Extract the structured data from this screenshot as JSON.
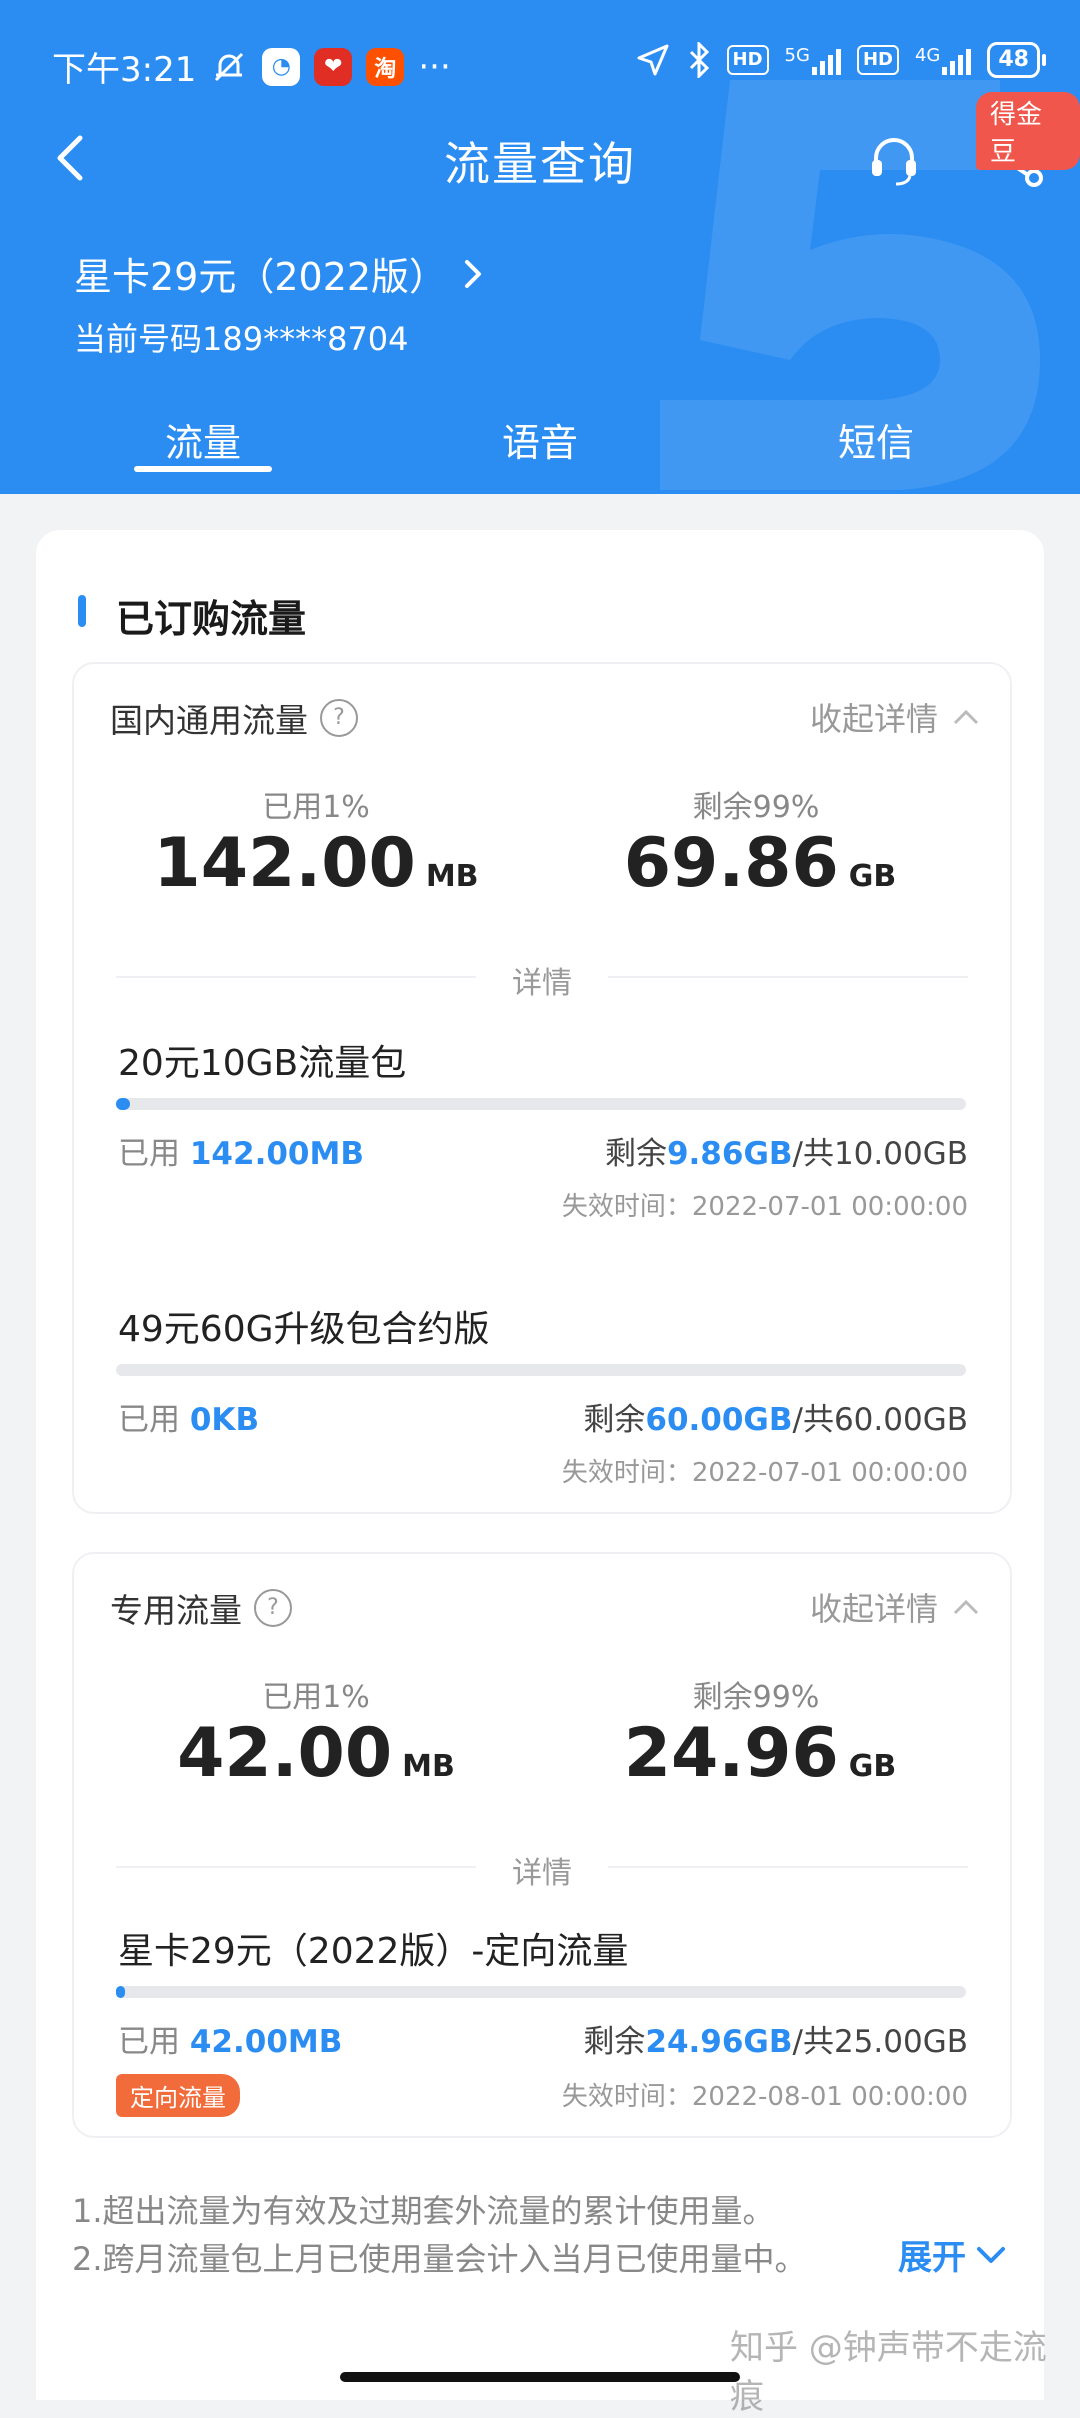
{
  "status_bar": {
    "time": "下午3:21",
    "app3": "淘",
    "more": "···",
    "sig1": "5G",
    "sig2": "4G",
    "hd": "HD",
    "battery": "48"
  },
  "header": {
    "title": "流量查询",
    "badge": "得金豆",
    "plan_name": "星卡29元（2022版）",
    "phone": "当前号码189****8704"
  },
  "tabs": [
    "流量",
    "语音",
    "短信"
  ],
  "section_title": "已订购流量",
  "domestic": {
    "title": "国内通用流量",
    "collapse_label": "收起详情",
    "used_label": "已用1%",
    "used_value": "142.00",
    "used_unit": "MB",
    "remain_label": "剩余99%",
    "remain_value": "69.86",
    "remain_unit": "GB",
    "detail_label": "详情",
    "packages": [
      {
        "name": "20元10GB流量包",
        "used_prefix": "已用",
        "used": "142.00MB",
        "remain_prefix": "剩余",
        "remain": "9.86GB",
        "total": "/共10.00GB",
        "expire": "失效时间：2022-07-01 00:00:00",
        "progress": 0.014
      },
      {
        "name": "49元60G升级包合约版",
        "used_prefix": "已用",
        "used": "0KB",
        "remain_prefix": "剩余",
        "remain": "60.00GB",
        "total": "/共60.00GB",
        "expire": "失效时间：2022-07-01 00:00:00",
        "progress": 0
      }
    ]
  },
  "dedicated": {
    "title": "专用流量",
    "collapse_label": "收起详情",
    "used_label": "已用1%",
    "used_value": "42.00",
    "used_unit": "MB",
    "remain_label": "剩余99%",
    "remain_value": "24.96",
    "remain_unit": "GB",
    "detail_label": "详情",
    "package": {
      "name": "星卡29元（2022版）-定向流量",
      "used_prefix": "已用",
      "used": "42.00MB",
      "remain_prefix": "剩余",
      "remain": "24.96GB",
      "total": "/共25.00GB",
      "expire": "失效时间：2022-08-01 00:00:00",
      "tag": "定向流量",
      "progress": 0.0017
    }
  },
  "notes": [
    "1.超出流量为有效及过期套外流量的累计使用量。",
    "2.跨月流量包上月已使用量会计入当月已使用量中。"
  ],
  "expand_label": "展开",
  "watermark": "知乎 @钟声带不走流痕",
  "colors": {
    "primary": "#2b8df2",
    "tag": "#f26b3a",
    "badge": "#f0564b"
  }
}
